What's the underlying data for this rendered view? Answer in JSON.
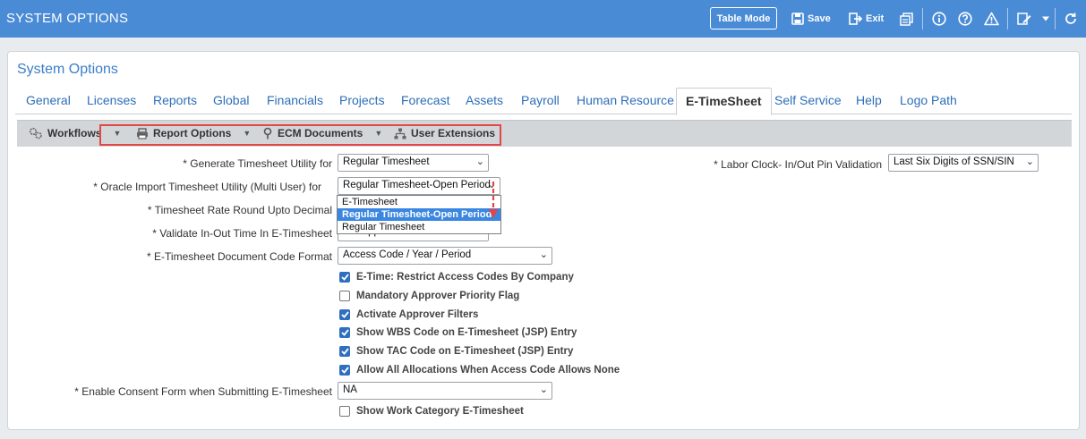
{
  "titlebar": {
    "title": "SYSTEM OPTIONS",
    "table_mode": "Table Mode",
    "save": "Save",
    "exit": "Exit"
  },
  "panel": {
    "title": "System Options"
  },
  "tabs": [
    {
      "label": "General"
    },
    {
      "label": "Licenses"
    },
    {
      "label": "Reports"
    },
    {
      "label": "Global"
    },
    {
      "label": "Financials"
    },
    {
      "label": "Projects"
    },
    {
      "label": "Forecast"
    },
    {
      "label": "Assets"
    },
    {
      "label": "Payroll"
    },
    {
      "label": "Human Resource"
    },
    {
      "label": "E-TimeSheet"
    },
    {
      "label": "Self Service"
    },
    {
      "label": "Help"
    },
    {
      "label": "Logo Path"
    }
  ],
  "active_tab": "E-TimeSheet",
  "toolbar": {
    "workflows": "Workflows",
    "report_options": "Report Options",
    "ecm_documents": "ECM Documents",
    "user_extensions": "User Extensions"
  },
  "form": {
    "generate_label": "* Generate Timesheet Utility for",
    "generate_value": "Regular Timesheet",
    "oracle_label": "* Oracle Import Timesheet Utility (Multi User) for",
    "oracle_value": "Regular Timesheet-Open Period",
    "rate_label": "* Timesheet Rate Round Upto Decimal",
    "validate_label": "* Validate In-Out Time In E-Timesheet",
    "validate_value": "Not Applicable",
    "doc_code_label": "* E-Timesheet Document Code Format",
    "doc_code_value": "Access Code / Year / Period",
    "consent_label": "* Enable Consent Form when Submitting E-Timesheet",
    "consent_value": "NA",
    "labor_label": "* Labor Clock- In/Out Pin Validation",
    "labor_value": "Last Six Digits of SSN/SIN"
  },
  "dropdown_options": [
    {
      "label": "E-Timesheet",
      "selected": false
    },
    {
      "label": "Regular Timesheet-Open Period",
      "selected": true
    },
    {
      "label": "Regular Timesheet",
      "selected": false
    }
  ],
  "checkboxes": [
    {
      "label": "E-Time: Restrict Access Codes By Company",
      "checked": true
    },
    {
      "label": "Mandatory Approver Priority Flag",
      "checked": false
    },
    {
      "label": "Activate Approver Filters",
      "checked": true
    },
    {
      "label": "Show WBS Code on E-Timesheet (JSP) Entry",
      "checked": true
    },
    {
      "label": "Show TAC Code on E-Timesheet (JSP) Entry",
      "checked": true
    },
    {
      "label": "Allow All Allocations When Access Code Allows None",
      "checked": true
    },
    {
      "label": "Show Work Category E-Timesheet",
      "checked": false
    }
  ],
  "colors": {
    "titlebar": "#4a8bd6",
    "accent": "#3a7fc8",
    "highlight": "#e04848",
    "selected_option": "#3a86e0"
  }
}
